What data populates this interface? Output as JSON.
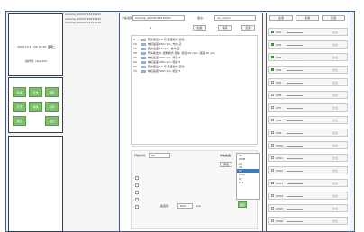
{
  "left": {
    "datetime": "2022-10-11 09:18:35, 星期二",
    "operator": "操作员: Operator",
    "buttons": [
      "系统",
      "日志",
      "帮助",
      "打开",
      "保存",
      "另存",
      "运行",
      "退出"
    ]
  },
  "files": [
    "scheme_20220718110021",
    "scheme_20220718133542",
    "scheme_20220722121416"
  ],
  "toolbar": {
    "scheme_label": "方案选择:",
    "scheme_value": "scheme_20220718110021",
    "note_label": "备注:",
    "note_value": "no_memo",
    "counter": "0",
    "load_btn": "加载",
    "save_btn": "保存",
    "apply_btn": "应用"
  },
  "log": [
    {
      "n": "0",
      "t": "",
      "msg": "开关量设:18 可,昼夜模式:自动"
    },
    {
      "n": "10",
      "t": "",
      "msg": "电机速度:250 rpm, 方向:正"
    },
    {
      "n": "20",
      "t": "",
      "msg": "开关速度:10 rpm, 方向:正"
    },
    {
      "n": "30",
      "t": "",
      "msg": "开关输出:8, 控制模式:自动, 频道:20 rpm, 频道:10 rpm"
    },
    {
      "n": "40",
      "t": "",
      "msg": "电机速度:300 rpm, 频道:5"
    },
    {
      "n": "50",
      "t": "",
      "msg": "电机速度:200 rpm, 频道:5"
    },
    {
      "n": "60",
      "t": "",
      "msg": "开关量设:15 可,昼夜模式:自动"
    },
    {
      "n": "70",
      "t": "",
      "msg": "电机速度:300 rpm, 频道:5"
    }
  ],
  "lower": {
    "time_label": "开始时间:",
    "time_value": "60",
    "param_label": "参数类型:",
    "param_value": "SP",
    "add_btn": "添加",
    "speed_label": "速度值:",
    "speed_value": "800",
    "speed_unit": "rpm",
    "confirm_btn": "确定",
    "options": [
      "SP",
      "PWM",
      "LR",
      "AN",
      "SP",
      "PDIO",
      "AF",
      "ALL"
    ],
    "selected_index": 4
  },
  "right": {
    "tabs": [
      "全选",
      "取消",
      "反选"
    ],
    "channels": [
      {
        "name": "CH1",
        "on": true
      },
      {
        "name": "CH2",
        "on": true
      },
      {
        "name": "CH3",
        "on": true
      },
      {
        "name": "CH4",
        "on": true
      },
      {
        "name": "CH5",
        "on": false
      },
      {
        "name": "CH6",
        "on": false
      },
      {
        "name": "CH7",
        "on": false
      },
      {
        "name": "CH8",
        "on": false
      },
      {
        "name": "CH9",
        "on": false
      },
      {
        "name": "CH10",
        "on": false
      },
      {
        "name": "CH11",
        "on": false
      },
      {
        "name": "CH12",
        "on": false
      },
      {
        "name": "CH13",
        "on": false
      },
      {
        "name": "CH14",
        "on": false
      },
      {
        "name": "CH15",
        "on": false
      },
      {
        "name": "CH16",
        "on": false
      }
    ],
    "value_text": "未设"
  }
}
